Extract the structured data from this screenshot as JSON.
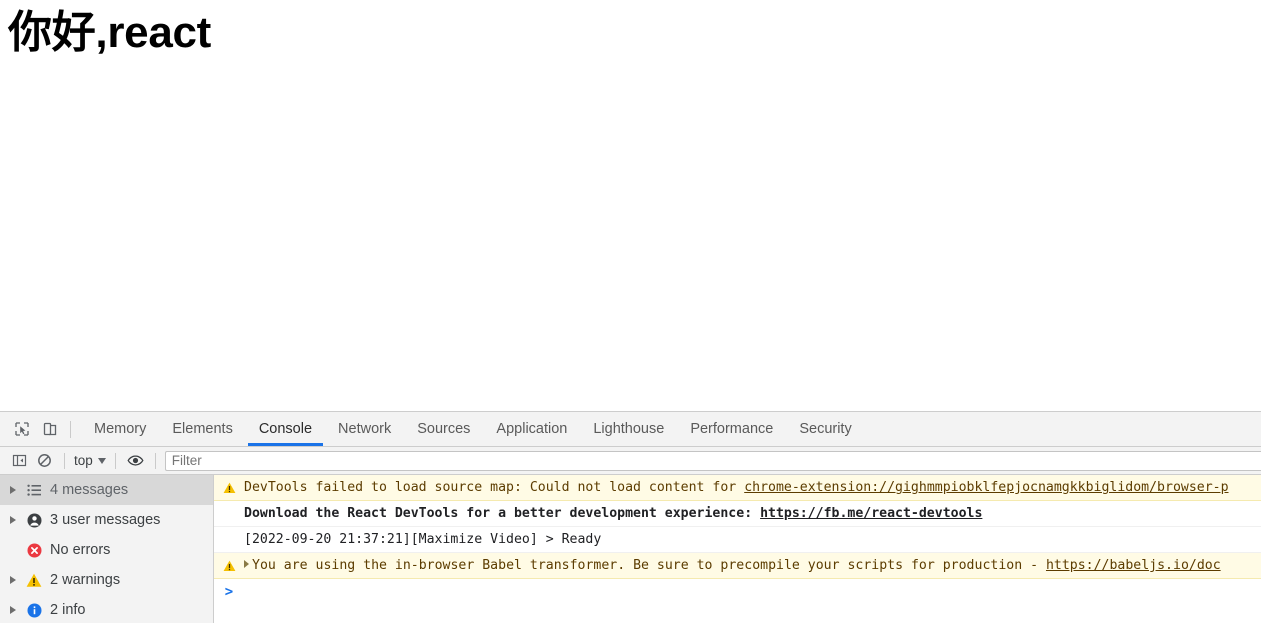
{
  "page": {
    "heading": "你好,react"
  },
  "devtools": {
    "tabbar": {
      "inspect_icon": "inspect-cursor-icon",
      "device_icon": "device-toolbar-icon",
      "tabs": [
        {
          "label": "Memory",
          "active": false
        },
        {
          "label": "Elements",
          "active": false
        },
        {
          "label": "Console",
          "active": true
        },
        {
          "label": "Network",
          "active": false
        },
        {
          "label": "Sources",
          "active": false
        },
        {
          "label": "Application",
          "active": false
        },
        {
          "label": "Lighthouse",
          "active": false
        },
        {
          "label": "Performance",
          "active": false
        },
        {
          "label": "Security",
          "active": false
        }
      ]
    },
    "toolbar": {
      "sidebar_toggle_icon": "sidebar-toggle-icon",
      "clear_console_icon": "clear-console-icon",
      "context_label": "top",
      "eye_icon": "eye-icon",
      "filter_placeholder": "Filter",
      "filter_value": ""
    },
    "sidebar": {
      "items": [
        {
          "label": "4 messages",
          "icon": "list-icon",
          "selected": true,
          "expandable": true
        },
        {
          "label": "3 user messages",
          "icon": "user-icon",
          "selected": false,
          "expandable": true
        },
        {
          "label": "No errors",
          "icon": "error-icon",
          "selected": false,
          "expandable": false
        },
        {
          "label": "2 warnings",
          "icon": "warning-icon",
          "selected": false,
          "expandable": true
        },
        {
          "label": "2 info",
          "icon": "info-icon",
          "selected": false,
          "expandable": true
        }
      ]
    },
    "messages": [
      {
        "level": "warning",
        "icon": "warning-icon",
        "expandable": false,
        "bold": false,
        "text": "DevTools failed to load source map: Could not load content for ",
        "link": "chrome-extension://gighmmpiobklfepjocnamgkkbiglidom/browser-p"
      },
      {
        "level": "plain",
        "icon": "",
        "expandable": false,
        "bold": true,
        "text": "Download the React DevTools for a better development experience: ",
        "link": "https://fb.me/react-devtools"
      },
      {
        "level": "plain",
        "icon": "",
        "expandable": false,
        "bold": false,
        "text": "[2022-09-20 21:37:21][Maximize Video] > Ready",
        "link": ""
      },
      {
        "level": "warning",
        "icon": "warning-icon",
        "expandable": true,
        "bold": false,
        "text": "You are using the in-browser Babel transformer. Be sure to precompile your scripts for production - ",
        "link": "https://babeljs.io/doc"
      }
    ],
    "prompt": {
      "chevron": ">",
      "value": ""
    },
    "colors": {
      "accent": "#1a73e8",
      "warning_bg": "#fffbe5",
      "warning_icon": "#f5c000",
      "error_icon": "#eb3941",
      "info_icon": "#1a73e8",
      "toolbar_bg": "#f3f3f3",
      "sidebar_selected_bg": "#d8d8d8"
    }
  }
}
